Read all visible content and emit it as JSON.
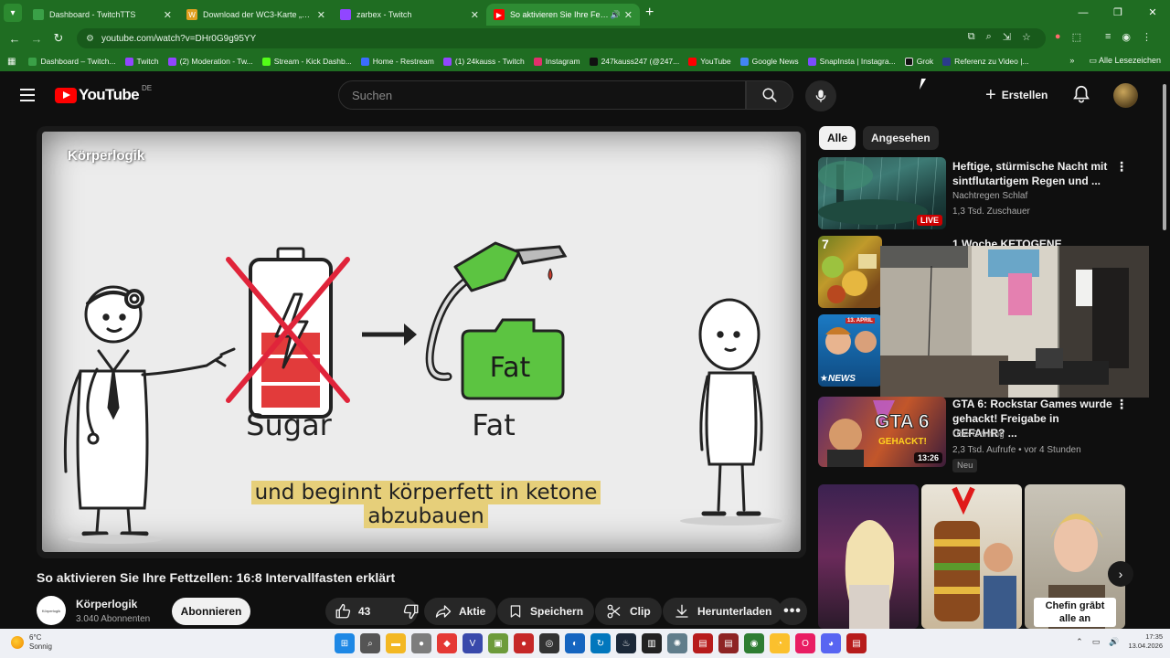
{
  "browser": {
    "tabs": [
      {
        "label": "Dashboard - TwitchTTS",
        "color": "#3aa047",
        "active": false
      },
      {
        "label": "Download der WC3-Karte „Ani",
        "color": "#e0a020",
        "active": false
      },
      {
        "label": "zarbex - Twitch",
        "color": "#9146ff",
        "active": false
      },
      {
        "label": "So aktivieren Sie Ihre Fettze",
        "color": "#ff0000",
        "active": true
      }
    ],
    "url": "youtube.com/watch?v=DHr0G9g95YY",
    "bookmarks": [
      {
        "label": "Dashboard – Twitch...",
        "color": "#3aa047"
      },
      {
        "label": "Twitch",
        "color": "#9146ff"
      },
      {
        "label": "(2) Moderation - Tw...",
        "color": "#9146ff"
      },
      {
        "label": "Stream - Kick Dashb...",
        "color": "#53fc18"
      },
      {
        "label": "Home - Restream",
        "color": "#3b6cff"
      },
      {
        "label": "(1) 24kauss - Twitch",
        "color": "#9146ff"
      },
      {
        "label": "Instagram",
        "color": "#e1306c"
      },
      {
        "label": "247kauss247 (@247...",
        "color": "#111111"
      },
      {
        "label": "YouTube",
        "color": "#ff0000"
      },
      {
        "label": "Google News",
        "color": "#4285f4"
      },
      {
        "label": "SnapInsta | Instagra...",
        "color": "#7b4cff"
      },
      {
        "label": "Grok",
        "color": "#111111"
      },
      {
        "label": "Referenz zu Video |...",
        "color": "#2b3b8c"
      }
    ],
    "all_bookmarks": "Alle Lesezeichen"
  },
  "masthead": {
    "logo": "YouTube",
    "country": "DE",
    "search_placeholder": "Suchen",
    "create_label": "Erstellen"
  },
  "video": {
    "watermark": "Körperlogik",
    "caption_line1": "und beginnt körperfett in ketone",
    "caption_line2": "abzubauen",
    "label_sugar": "Sugar",
    "label_fat": "Fat",
    "label_fat_can": "Fat",
    "title": "So aktivieren Sie Ihre Fettzellen: 16:8 Intervallfasten erklärt",
    "channel": "Körperlogik",
    "channel_avatar_text": "Körperlogik",
    "subscribers": "3.040 Abonnenten",
    "subscribe": "Abonnieren",
    "likes": "43",
    "share": "Aktie",
    "save": "Speichern",
    "clip": "Clip",
    "download": "Herunterladen"
  },
  "sidebar": {
    "chips": [
      "Alle",
      "Angesehen"
    ],
    "recos": [
      {
        "title": "Heftige, stürmische Nacht mit sintflutartigem Regen und ...",
        "channel": "Nachtregen Schlaf",
        "meta": "1,3 Tsd. Zuschauer",
        "badge": "LIVE"
      },
      {
        "title": "1 Woche KETOGENE Ernährung",
        "channel": "",
        "meta": "",
        "badge": ""
      },
      {
        "title": "",
        "channel": "",
        "meta": "",
        "badge": "NEWS",
        "thumb_date": "13. APRIL"
      },
      {
        "title": "GTA 6: Rockstar Games wurde gehackt! Freigabe in GEFAHR? ...",
        "channel": "ÜberGaming",
        "meta": "2,3 Tsd. Aufrufe • vor 4 Stunden",
        "badge": "13:26",
        "new": "Neu",
        "thumb_big": "GTA 6",
        "thumb_sub": "GEHACKT!"
      }
    ],
    "shorts_caption": "Chefin grābt alle an"
  },
  "taskbar": {
    "temp": "6°C",
    "weather": "Sonnig",
    "time": "17:35",
    "date": "13.04.2026"
  }
}
